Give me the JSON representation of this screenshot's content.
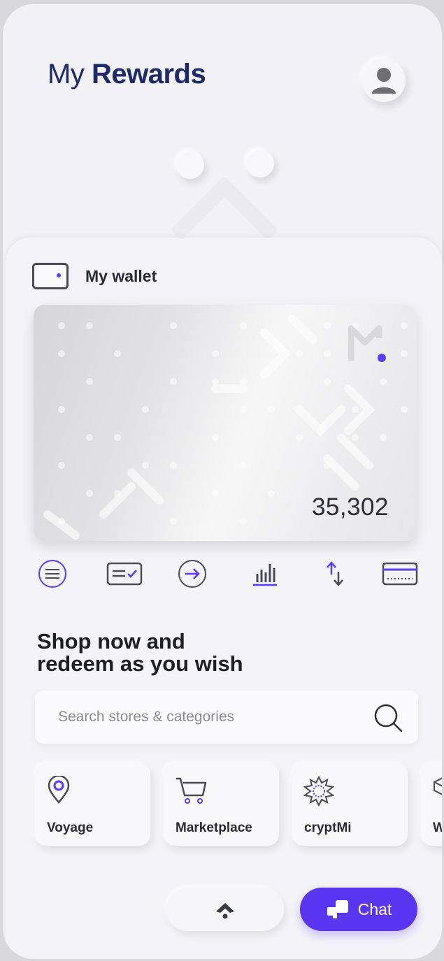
{
  "header": {
    "title_light": "My",
    "title_bold": "Rewards",
    "avatar_icon": "user-avatar-icon"
  },
  "wallet": {
    "label": "My wallet",
    "icon": "wallet-icon",
    "balance": "35,302"
  },
  "actions": [
    {
      "name": "menu-lines-icon"
    },
    {
      "name": "card-check-icon"
    },
    {
      "name": "arrow-right-circle-icon"
    },
    {
      "name": "bar-chart-icon"
    },
    {
      "name": "transfer-arrows-icon"
    },
    {
      "name": "credit-card-icon"
    }
  ],
  "shop": {
    "title_line1": "Shop now and",
    "title_line2": "redeem as you wish"
  },
  "search": {
    "placeholder": "Search stores & categories"
  },
  "categories": [
    {
      "label": "Voyage",
      "icon": "location-pin-icon"
    },
    {
      "label": "Marketplace",
      "icon": "shopping-cart-icon"
    },
    {
      "label": "cryptMi",
      "icon": "crypto-burst-icon"
    },
    {
      "label": "W",
      "icon": "cube-icon"
    }
  ],
  "bottom": {
    "up_icon": "chevron-up-icon",
    "chat_label": "Chat",
    "chat_icon": "chat-icon"
  },
  "colors": {
    "brand_navy": "#1f2a6b",
    "accent_purple": "#5a36f0",
    "background": "#f2f2f6"
  }
}
